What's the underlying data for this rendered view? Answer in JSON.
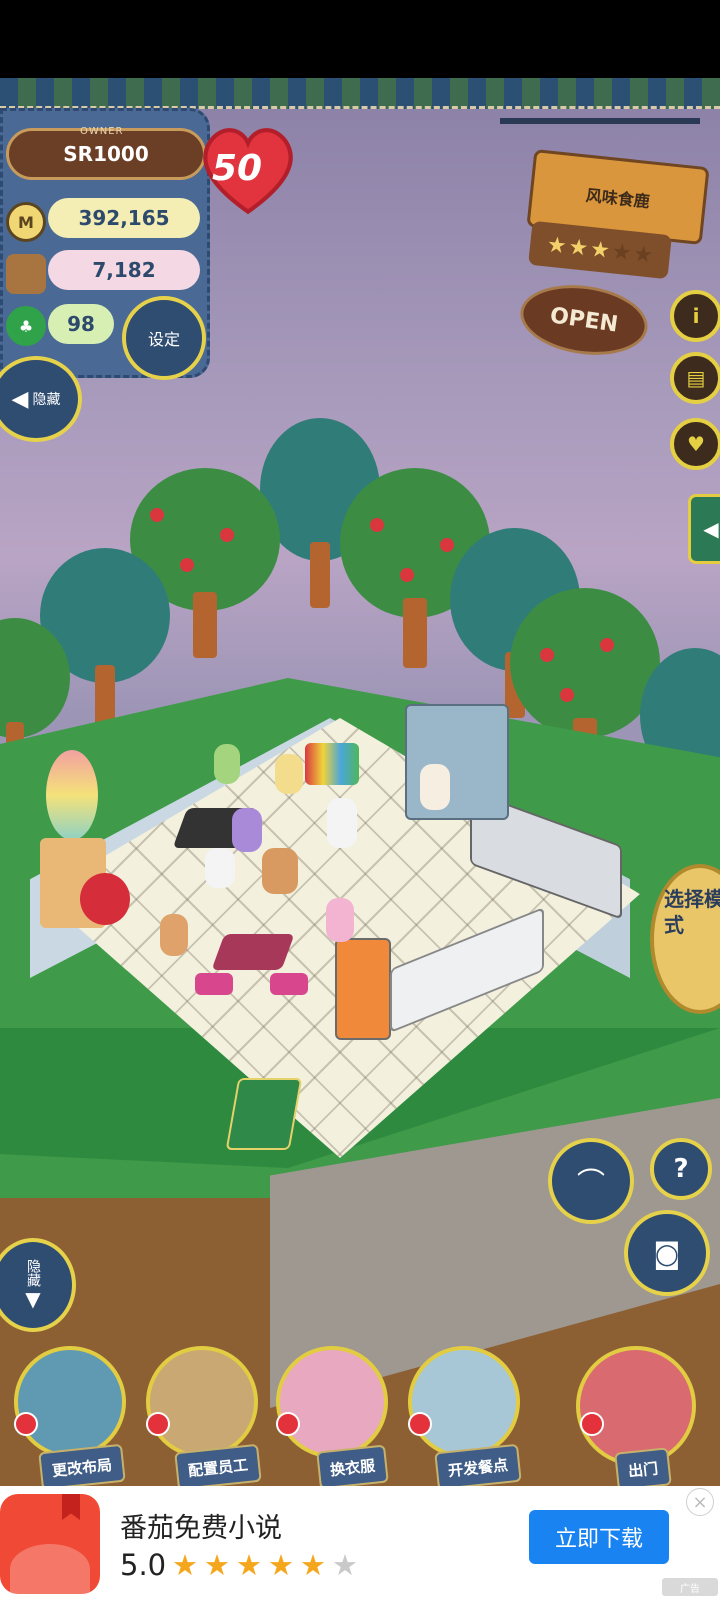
{
  "hud": {
    "owner_tag": "OWNER",
    "owner_name": "SR1000",
    "level": "50",
    "money": "392,165",
    "food": "7,182",
    "clover": "98",
    "settings_label": "设定",
    "hide_top_label": "隐藏",
    "hide_bottom_label": "隐藏"
  },
  "restaurant": {
    "name": "风味食鹿",
    "stars_filled": 3,
    "stars_total": 5,
    "status": "OPEN"
  },
  "side_buttons": {
    "info_icon": "i",
    "book_icon": "book-icon",
    "heart_icon": "heart-icon",
    "tab_arrow": "◀"
  },
  "mode_button": {
    "label": "选择模式"
  },
  "right_controls": {
    "help": "?"
  },
  "bottom_menu": [
    {
      "label": "更改布局"
    },
    {
      "label": "配置员工"
    },
    {
      "label": "换衣服"
    },
    {
      "label": "开发餐点"
    },
    {
      "label": "出门"
    }
  ],
  "ad": {
    "title": "番茄免费小说",
    "rating": "5.0",
    "stars_on": "★★★★★",
    "stars_off": "★",
    "cta": "立即下载",
    "close": "×",
    "badge": "广告"
  },
  "colors": {
    "hud_blue": "#3f5d86",
    "gold_border": "#e2cc42",
    "grass": "#3f9a49",
    "cta_blue": "#1a83f2",
    "star_orange": "#f4a71c"
  }
}
